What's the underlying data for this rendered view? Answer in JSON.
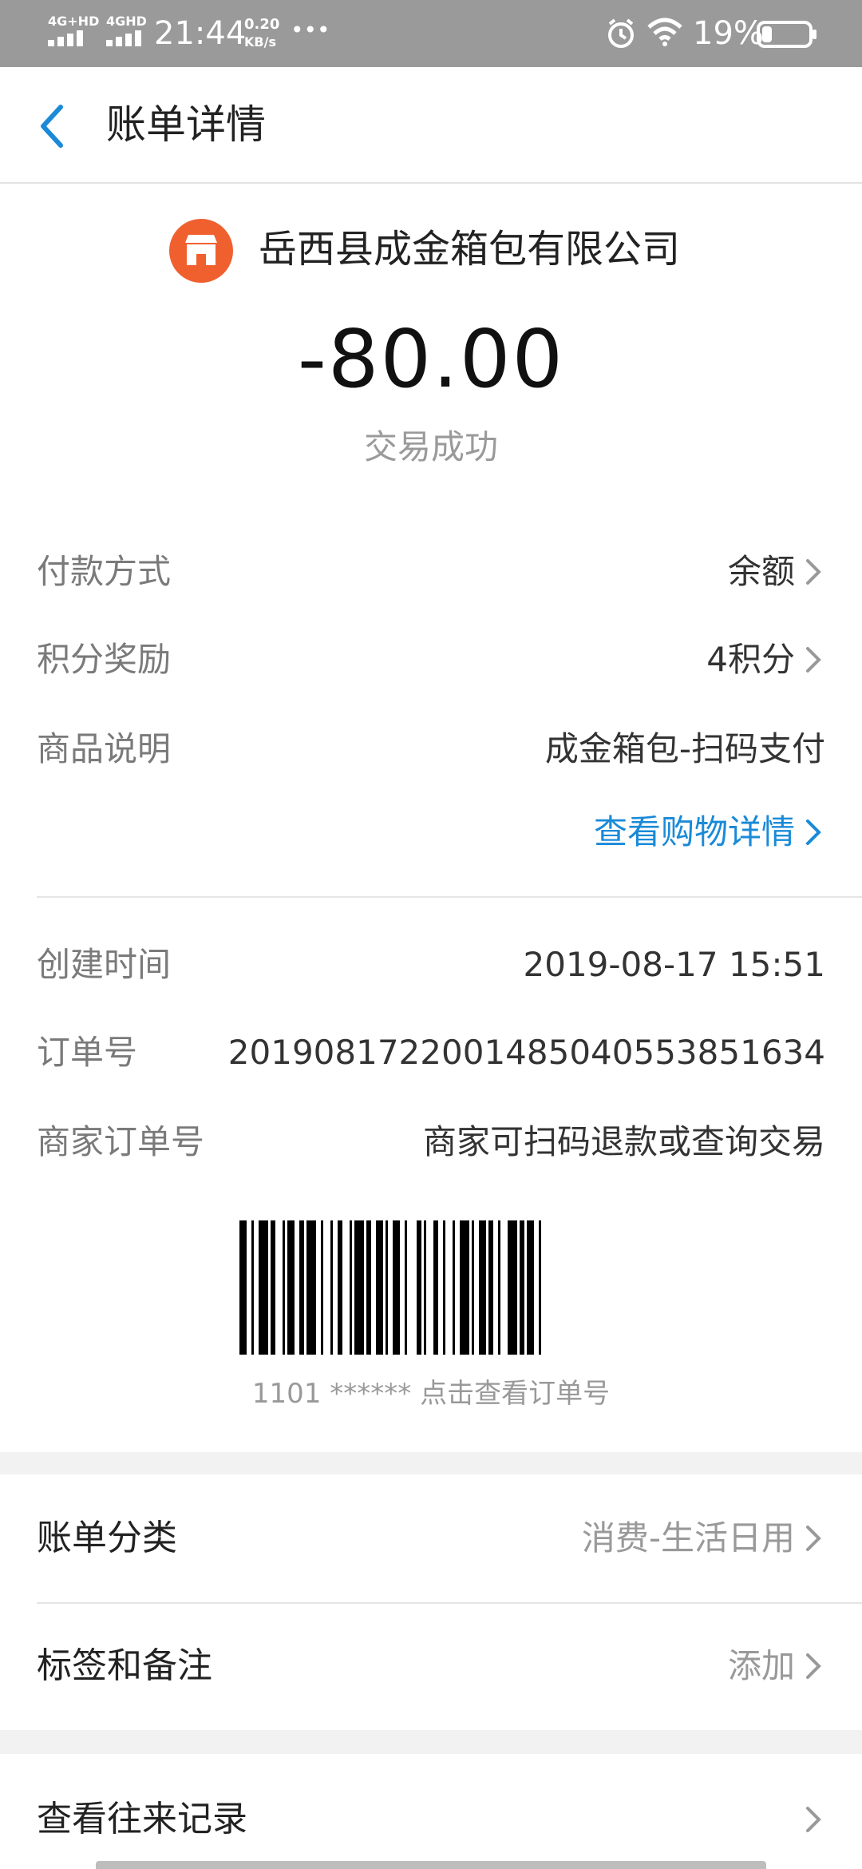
{
  "status_bar": {
    "network1": "4G+HD",
    "network2": "4GHD",
    "time": "21:44",
    "speed_value": "0.20",
    "speed_unit": "KB/s",
    "more": "•••",
    "battery": "19%",
    "icons": [
      "signal-icon",
      "signal-icon",
      "alarm-icon",
      "wifi-icon",
      "battery-icon"
    ]
  },
  "header": {
    "title": "账单详情",
    "back_icon": "chevron-left-icon"
  },
  "merchant": {
    "name": "岳西县成金箱包有限公司",
    "icon": "shop-icon",
    "icon_color": "#f0602f"
  },
  "amount": "-80.00",
  "status": "交易成功",
  "details": [
    {
      "label": "付款方式",
      "value": "余额",
      "chevron": true
    },
    {
      "label": "积分奖励",
      "value": "4积分",
      "chevron": true
    },
    {
      "label": "商品说明",
      "value": "成金箱包-扫码支付",
      "chevron": false
    }
  ],
  "shopping_link": "查看购物详情",
  "order_info": [
    {
      "label": "创建时间",
      "value": "2019-08-17 15:51"
    },
    {
      "label": "订单号",
      "value": "2019081722001485040553851634"
    },
    {
      "label": "商家订单号",
      "value": "商家可扫码退款或查询交易"
    }
  ],
  "barcode_caption": "1101 ****** 点击查看订单号",
  "bill_category": {
    "label": "账单分类",
    "value": "消费-生活日用"
  },
  "tags": {
    "label": "标签和备注",
    "value": "添加"
  },
  "history": {
    "label": "查看往来记录"
  },
  "colors": {
    "accent": "#1a8ad8",
    "status_bar": "#9a9a9a",
    "background": "#f2f2f2"
  }
}
